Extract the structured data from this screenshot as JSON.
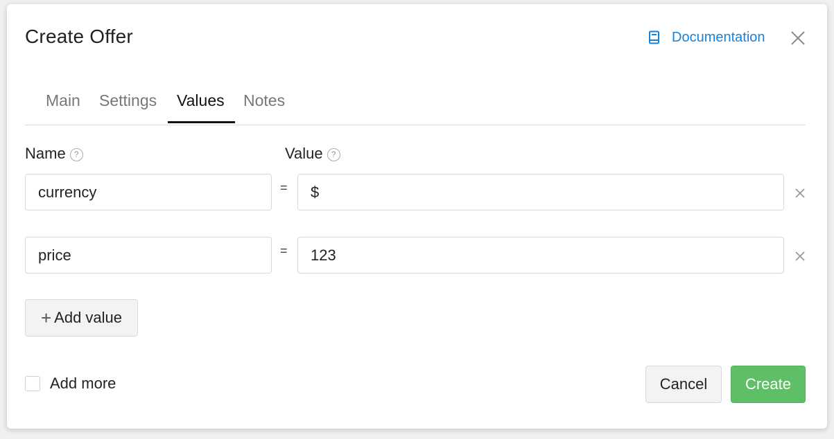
{
  "dialog": {
    "title": "Create Offer",
    "documentation_label": "Documentation",
    "documentation_icon": "book-icon",
    "close_icon": "close-icon"
  },
  "tabs": [
    {
      "label": "Main",
      "active": false
    },
    {
      "label": "Settings",
      "active": false
    },
    {
      "label": "Values",
      "active": true
    },
    {
      "label": "Notes",
      "active": false
    }
  ],
  "columns": {
    "name_label": "Name",
    "value_label": "Value",
    "help_glyph": "?"
  },
  "rows": [
    {
      "name": "currency",
      "separator": "=",
      "value": "$"
    },
    {
      "name": "price",
      "separator": "=",
      "value": "123"
    }
  ],
  "add_value": {
    "plus": "+",
    "label": "Add value"
  },
  "footer": {
    "add_more_label": "Add more",
    "add_more_checked": false,
    "cancel_label": "Cancel",
    "create_label": "Create"
  },
  "colors": {
    "link": "#1a82d6",
    "primary": "#5fbf67",
    "active_tab": "#111111",
    "inactive_tab": "#777777"
  }
}
